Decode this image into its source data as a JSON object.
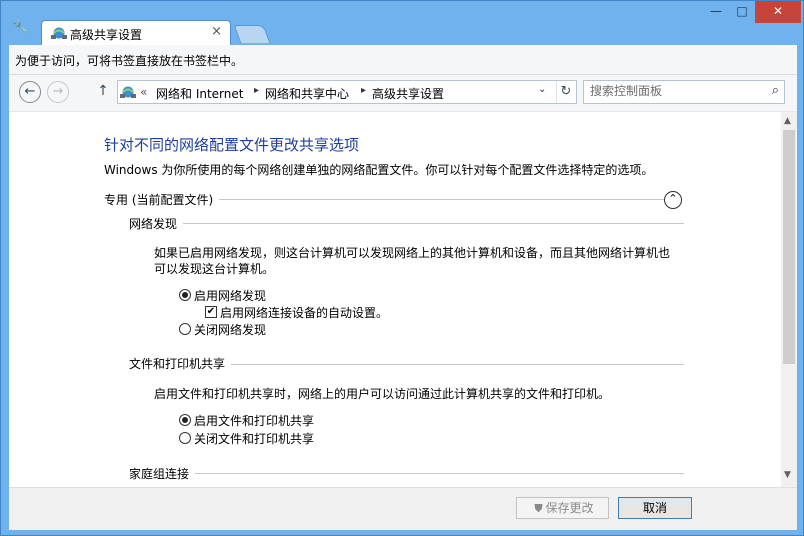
{
  "window": {
    "tab_title": "高级共享设置",
    "tab_close": "×",
    "min": "—",
    "max": "□",
    "close": "✕",
    "wrench_icon": "wrench-icon"
  },
  "favbar": {
    "text": "为便于访问，可将书签直接放在书签栏中。"
  },
  "navbar": {
    "back": "←",
    "forward": "→",
    "up": "↑",
    "overflow": "«",
    "crumbs": [
      "网络和 Internet",
      "网络和共享中心",
      "高级共享设置"
    ],
    "separator": "▸",
    "dropdown": "⌄",
    "refresh": "↻",
    "search_placeholder": "搜索控制面板",
    "search_icon": "⌕"
  },
  "content": {
    "title": "针对不同的网络配置文件更改共享选项",
    "description": "Windows 为你所使用的每个网络创建单独的网络配置文件。你可以针对每个配置文件选择特定的选项。",
    "profile": {
      "label": "专用 (当前配置文件)",
      "collapse": "⌃"
    },
    "network_discovery": {
      "title": "网络发现",
      "para1": "如果已启用网络发现，则这台计算机可以发现网络上的其他计算机和设备，而且其他网络计算机也",
      "para2": "可以发现这台计算机。",
      "on": "启用网络发现",
      "auto": "启用网络连接设备的自动设置。",
      "off": "关闭网络发现",
      "selected": "on",
      "auto_checked": true
    },
    "file_sharing": {
      "title": "文件和打印机共享",
      "para": "启用文件和打印机共享时，网络上的用户可以访问通过此计算机共享的文件和打印机。",
      "on": "启用文件和打印机共享",
      "off": "关闭文件和打印机共享",
      "selected": "on"
    },
    "homegroup": {
      "title": "家庭组连接"
    }
  },
  "footer": {
    "save": "保存更改",
    "cancel": "取消"
  },
  "colors": {
    "title_blue": "#1f3f9b",
    "frame": "#6fb2ee",
    "close_red": "#c7443b"
  }
}
